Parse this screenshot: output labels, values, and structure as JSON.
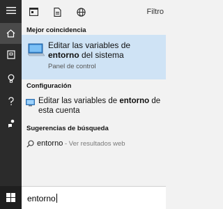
{
  "topbar": {
    "filter_label": "Filtro",
    "icons": [
      "apps-icon",
      "document-icon",
      "web-globe-icon"
    ]
  },
  "rail": {
    "items": [
      "hamburger-menu-icon",
      "home-icon",
      "notebook-icon",
      "lightbulb-icon",
      "help-icon",
      "feedback-icon"
    ]
  },
  "sections": {
    "best_match": "Mejor coincidencia",
    "settings": "Configuración",
    "suggestions": "Sugerencias de búsqueda"
  },
  "best_result": {
    "title_before": "Editar las variables de ",
    "title_highlight": "entorno",
    "title_after": " del sistema",
    "subtitle": "Panel de control"
  },
  "settings_result": {
    "title_before": "Editar las variables de ",
    "title_highlight": "entorno",
    "title_after": " de esta cuenta"
  },
  "suggestion": {
    "term": "entorno",
    "suffix": " - Ver resultados web"
  },
  "search": {
    "query": "entorno"
  },
  "colors": {
    "rail": "#2b2b2b",
    "selected": "#cfe3f5",
    "accent": "#0078d7"
  }
}
